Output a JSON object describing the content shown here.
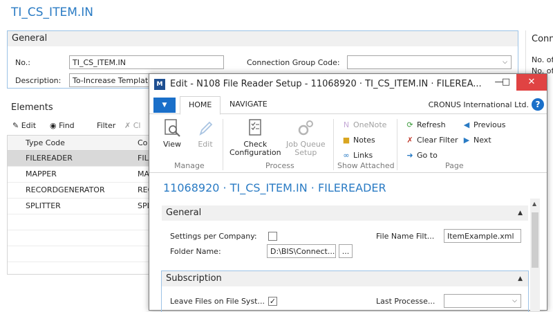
{
  "background": {
    "title": "TI_CS_ITEM.IN",
    "general": {
      "header": "General",
      "no_label": "No.:",
      "no_value": "TI_CS_ITEM.IN",
      "description_label": "Description:",
      "description_value": "To-Increase Template",
      "connection_group_label": "Connection Group Code:",
      "connection_group_value": ""
    },
    "elements": {
      "header": "Elements",
      "toolbar": {
        "edit": "Edit",
        "find": "Find",
        "filter": "Filter",
        "clear": "Cl"
      },
      "columns": [
        "Type Code",
        "Co"
      ],
      "rows": [
        {
          "type_code": "FILEREADER",
          "code": "FILE",
          "selected": true
        },
        {
          "type_code": "MAPPER",
          "code": "MA",
          "selected": false
        },
        {
          "type_code": "RECORDGENERATOR",
          "code": "REC",
          "selected": false
        },
        {
          "type_code": "SPLITTER",
          "code": "SPL",
          "selected": false
        }
      ]
    },
    "right_panel": {
      "header": "Conn",
      "lines": [
        "No. of",
        "No. of",
        "",
        "",
        "",
        "",
        "",
        ""
      ]
    }
  },
  "modal": {
    "title": "Edit - N108 File Reader Setup - 11068920 · TI_CS_ITEM.IN · FILEREA...",
    "ribbon_tabs": {
      "home": "HOME",
      "navigate": "NAVIGATE"
    },
    "company": "CRONUS International Ltd.",
    "ribbon": {
      "view": "View",
      "edit": "Edit",
      "manage": "Manage",
      "check_configuration_1": "Check",
      "check_configuration_2": "Configuration",
      "job_queue_1": "Job Queue",
      "job_queue_2": "Setup",
      "process": "Process",
      "onenote": "OneNote",
      "notes": "Notes",
      "links": "Links",
      "show_attached": "Show Attached",
      "refresh": "Refresh",
      "clear_filter": "Clear Filter",
      "go_to": "Go to",
      "previous": "Previous",
      "next": "Next",
      "page": "Page"
    },
    "page_title": "11068920 · TI_CS_ITEM.IN · FILEREADER",
    "general": {
      "header": "General",
      "settings_per_company_label": "Settings per Company:",
      "settings_per_company_checked": false,
      "folder_name_label": "Folder Name:",
      "folder_name_value": "D:\\BIS\\Connect...",
      "file_name_filter_label": "File Name Filt...",
      "file_name_filter_value": "ItemExample.xml",
      "browse": "..."
    },
    "subscription": {
      "header": "Subscription",
      "leave_files_label": "Leave Files on File Syst...",
      "leave_files_checked": true,
      "last_processed_label": "Last Processe...",
      "last_processed_value": ""
    }
  }
}
